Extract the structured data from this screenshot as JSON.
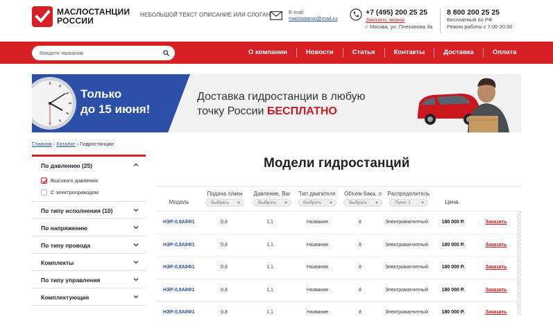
{
  "brand": {
    "name_line1": "МАСЛОСТАНЦИИ",
    "name_line2": "РОССИИ",
    "slogan": "НЕБОЛЬШОЙ ТЕКСТ ОПИСАНИЕ ИЛИ СЛОГАН"
  },
  "contacts": {
    "email_caption": "E-mail",
    "email": "maslostanoi@mail.ru",
    "phone": "+7 (495) 200 25 25",
    "call_link": "Заказать звонок",
    "address": "г. Москва, ул. Плеханова 3а",
    "free_phone": "8 800 200 25 25",
    "free_caption": "Бесплатный по РФ",
    "hours": "Режим работы с 7.00-20.00"
  },
  "search": {
    "placeholder": "Введите название"
  },
  "menu": [
    "О компании",
    "Новости",
    "Статья",
    "Контакты",
    "Доставка",
    "Оплата"
  ],
  "banner": {
    "promo_line1": "Только",
    "promo_line2": "до 15 июня!",
    "text_line1": "Доставка гидростанции в любую",
    "text_line2": "точку России ",
    "text_free": "БЕСПЛАТНО"
  },
  "breadcrumb": {
    "home": "Главная",
    "catalog": "Каталог",
    "current": "Гидростанции",
    "sep": " › "
  },
  "sidebar": {
    "open_section": "По давлению (25)",
    "options": [
      {
        "label": "Высокого давления",
        "checked": true
      },
      {
        "label": "С электроприводом",
        "checked": false
      }
    ],
    "sections": [
      "По типу исполнения (10)",
      "По напряжению",
      "По типу провода",
      "Комплекты",
      "По типу управления",
      "Комплектующие"
    ]
  },
  "page_title": "Модели гидростанций",
  "table": {
    "columns": {
      "model": "Модель",
      "flow": "Подача л/мин",
      "pressure": "Давление, Bar",
      "engine": "Тип двигателя",
      "tank": "Объем бака, л",
      "distributor": "Распределитель",
      "price": "Цена"
    },
    "filter_default": "Выбрать",
    "distributor_default": "Пункт 1",
    "rows": [
      {
        "model": "НЭР-0,8А8Ф1",
        "flow": "0,8",
        "pressure": "1,1",
        "engine": "Название",
        "tank": "8",
        "distributor": "Электромагнитный",
        "price": "180 000 Р.",
        "order": "Заказать"
      },
      {
        "model": "НЭР-0,8А8Ф1",
        "flow": "0,8",
        "pressure": "1,1",
        "engine": "Название",
        "tank": "8",
        "distributor": "Электромагнитный",
        "price": "180 000 Р.",
        "order": "Заказать"
      },
      {
        "model": "НЭР-0,8А8Ф1",
        "flow": "0,8",
        "pressure": "1,1",
        "engine": "Название",
        "tank": "8",
        "distributor": "Электромагнитный",
        "price": "180 000 Р.",
        "order": "Заказать"
      },
      {
        "model": "НЭР-0,8А8Ф1",
        "flow": "0,8",
        "pressure": "1,1",
        "engine": "Название",
        "tank": "8",
        "distributor": "Электромагнитный",
        "price": "180 000 Р.",
        "order": "Заказать"
      },
      {
        "model": "НЭР-0,8А8Ф1",
        "flow": "0,8",
        "pressure": "1,1",
        "engine": "Название",
        "tank": "8",
        "distributor": "Электромагнитный",
        "price": "180 000 Р.",
        "order": "Заказать"
      }
    ]
  },
  "colors": {
    "accent": "#d71f26",
    "link": "#2c54a4",
    "banner_blue": "#2c4fa8"
  }
}
